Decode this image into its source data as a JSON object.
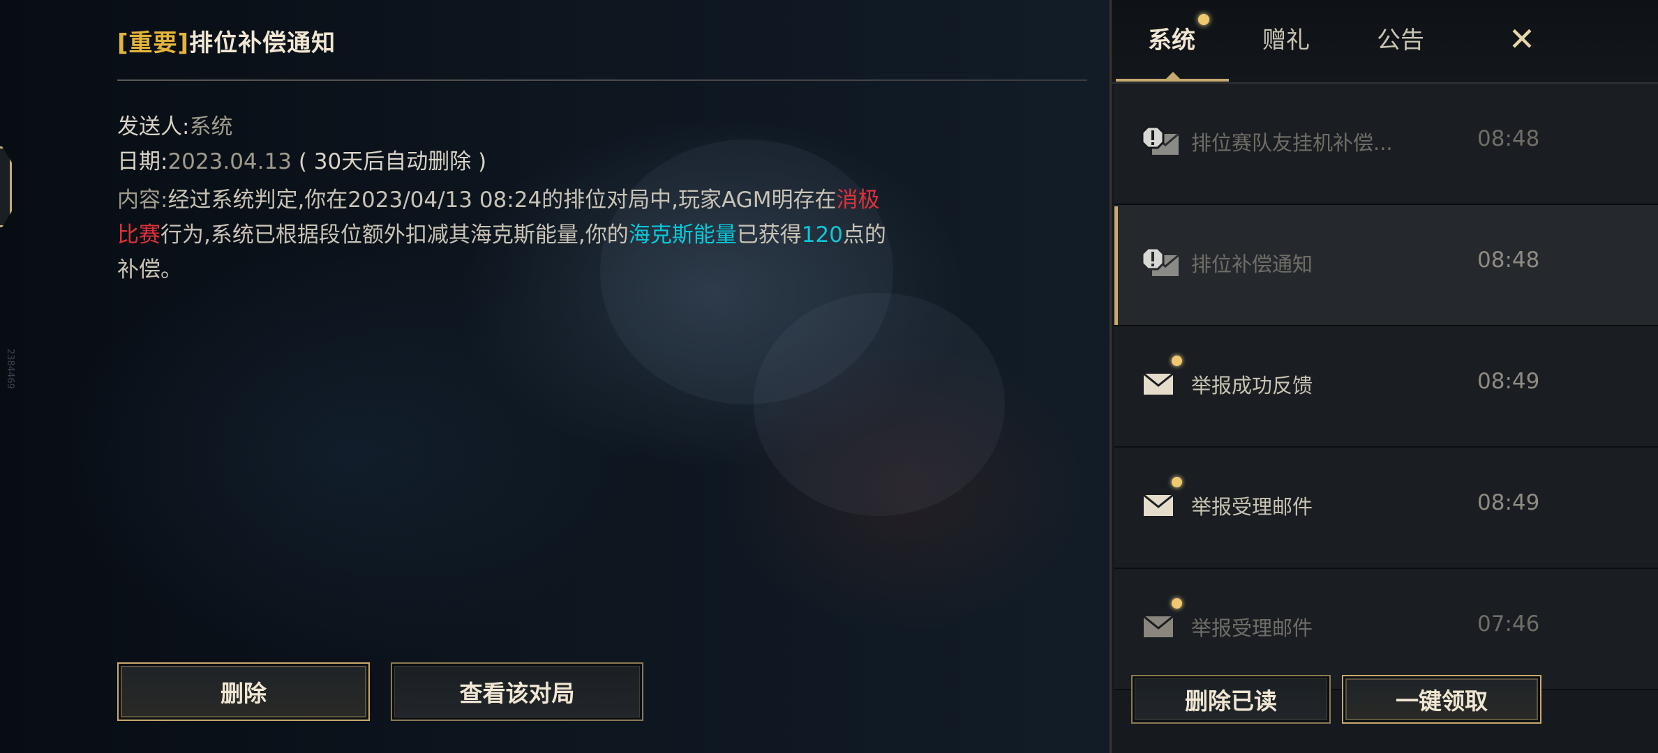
{
  "detail": {
    "title_tag": "[重要]",
    "title": "排位补偿通知",
    "sender_label": "发送人:",
    "sender": "系统",
    "date_label": "日期:",
    "date": "2023.04.13",
    "date_note": "( 30天后自动删除 )",
    "content_label": "内容:",
    "content_part1": "经过系统判定,你在2023/04/13 08:24的排位对局中,玩家AGM明存在",
    "content_red": "消极比赛",
    "content_part2": "行为,系统已根据段位额外扣减其海克斯能量,你的",
    "content_cyan": "海克斯能量",
    "content_part3": "已获得",
    "content_points": "120",
    "content_part4": "点的补偿。",
    "delete_button": "删除",
    "view_match_button": "查看该对局"
  },
  "side_id": "2384469",
  "tabs": [
    {
      "label": "系统",
      "active": true,
      "has_dot": true
    },
    {
      "label": "赠礼",
      "active": false
    },
    {
      "label": "公告",
      "active": false
    }
  ],
  "close_icon": "close-x-icon",
  "mails": [
    {
      "subject": "排位赛队友挂机补偿...",
      "time": "08:48",
      "icon": "alert-mail-icon",
      "read": true,
      "unread_dot": false,
      "selected": false
    },
    {
      "subject": "排位补偿通知",
      "time": "08:48",
      "icon": "alert-mail-icon",
      "read": true,
      "unread_dot": false,
      "selected": true
    },
    {
      "subject": "举报成功反馈",
      "time": "08:49",
      "icon": "envelope-icon",
      "read": false,
      "unread_dot": true,
      "selected": false
    },
    {
      "subject": "举报受理邮件",
      "time": "08:49",
      "icon": "envelope-icon",
      "read": false,
      "unread_dot": true,
      "selected": false
    },
    {
      "subject": "举报受理邮件",
      "time": "07:46",
      "icon": "envelope-icon",
      "read": false,
      "unread_dot": true,
      "selected": false
    }
  ],
  "footer": {
    "delete_read_button": "删除已读",
    "claim_all_button": "一键领取"
  },
  "colors": {
    "gold": "#c8aa6e",
    "tag_gold": "#e3b43a",
    "negative_red": "#e0313a",
    "hextech_cyan": "#0ac8d9"
  }
}
